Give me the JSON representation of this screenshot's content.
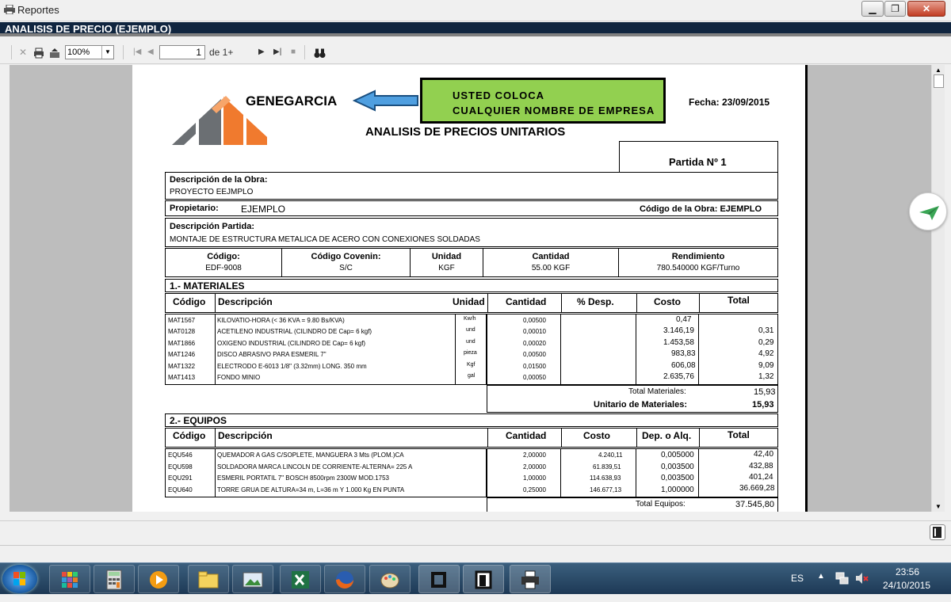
{
  "window": {
    "title": "Reportes"
  },
  "report_header": "ANALISIS DE PRECIO (EJEMPLO)",
  "toolbar": {
    "zoom": "100%",
    "page": "1",
    "page_of": "de 1+"
  },
  "doc": {
    "company": "GENEGARCIA",
    "note_line1": "USTED  COLOCA",
    "note_line2": "CUALQUIER NOMBRE DE EMPRESA",
    "fecha": "Fecha: 23/09/2015",
    "title": "ANALISIS DE PRECIOS UNITARIOS",
    "partida": "Partida Nº  1",
    "obra_label": "Descripción de la Obra:",
    "obra_value": "PROYECTO EEJMPLO",
    "propietario_label": "Propietario:",
    "propietario_value": "EJEMPLO",
    "codigo_obra": "Código de la Obra: EJEMPLO",
    "partida_desc_label": "Descripción Partida:",
    "partida_desc_value": "MONTAJE DE ESTRUCTURA METALICA DE ACERO CON CONEXIONES SOLDADAS",
    "info_headers": [
      "Código:",
      "Código Covenin:",
      "Unidad",
      "Cantidad",
      "Rendimiento"
    ],
    "info_values": [
      "EDF-9008",
      "S/C",
      "KGF",
      "55.00 KGF",
      "780.540000  KGF/Turno"
    ],
    "mat_title": "1.-  MATERIALES",
    "mat_headers": [
      "Código",
      "Descripción",
      "Unidad",
      "Cantidad",
      "% Desp.",
      "Costo",
      "Total"
    ],
    "materiales": [
      {
        "code": "MAT1567",
        "desc": "KILOVATIO-HORA (< 36 KVA = 9.80 Bs/KVA)",
        "unit": "Kw/h",
        "qty": "0,00500",
        "cost": "0,47",
        "total": ""
      },
      {
        "code": "MAT0128",
        "desc": "ACETILENO INDUSTRIAL (CILINDRO DE Cap= 6 kgf)",
        "unit": "und",
        "qty": "0,00010",
        "cost": "3.146,19",
        "total": "0,31"
      },
      {
        "code": "MAT1866",
        "desc": "OXIGENO INDUSTRIAL (CILINDRO DE Cap= 6 kgf)",
        "unit": "und",
        "qty": "0,00020",
        "cost": "1.453,58",
        "total": "0,29"
      },
      {
        "code": "MAT1246",
        "desc": "DISCO ABRASIVO PARA ESMERIL 7\"",
        "unit": "pieza",
        "qty": "0,00500",
        "cost": "983,83",
        "total": "4,92"
      },
      {
        "code": "MAT1322",
        "desc": "ELECTRODO E-6013 1/8\" (3.32mm) LONG. 350 mm",
        "unit": "Kgf",
        "qty": "0,01500",
        "cost": "606,08",
        "total": "9,09"
      },
      {
        "code": "MAT1413",
        "desc": "FONDO MINIO",
        "unit": "gal",
        "qty": "0,00050",
        "cost": "2.635,76",
        "total": "1,32"
      }
    ],
    "total_materiales_label": "Total Materiales:",
    "total_materiales": "15,93",
    "unitario_materiales_label": "Unitario de Materiales:",
    "unitario_materiales": "15,93",
    "eq_title": "2.-  EQUIPOS",
    "eq_headers": [
      "Código",
      "Descripción",
      "Cantidad",
      "Costo",
      "Dep. o Alq.",
      "Total"
    ],
    "equipos": [
      {
        "code": "EQU546",
        "desc": "QUEMADOR A GAS C/SOPLETE, MANGUERA 3 Mts (PLOM.)CA",
        "qty": "2,00000",
        "cost": "4.240,11",
        "dep": "0,005000",
        "total": "42,40"
      },
      {
        "code": "EQU598",
        "desc": "SOLDADORA MARCA LINCOLN DE CORRIENTE-ALTERNA= 225 A",
        "qty": "2,00000",
        "cost": "61.839,51",
        "dep": "0,003500",
        "total": "432,88"
      },
      {
        "code": "EQU291",
        "desc": "ESMERIL PORTATIL 7\" BOSCH 8500rpm 2300W MOD.1753",
        "qty": "1,00000",
        "cost": "114.638,93",
        "dep": "0,003500",
        "total": "401,24"
      },
      {
        "code": "EQU640",
        "desc": "TORRE GRUA DE ALTURA=34 m, L=36 m Y 1.000 Kg EN PUNTA",
        "qty": "0,25000",
        "cost": "146.677,13",
        "dep": "1,000000",
        "total": "36.669,28"
      }
    ],
    "total_equipos_label": "Total Equipos:",
    "total_equipos": "37.545,80"
  },
  "tray": {
    "lang": "ES",
    "time": "23:56",
    "date": "24/10/2015"
  },
  "colors": {
    "header_bg": "#10253f",
    "note_bg": "#92d050",
    "logo_orange": "#f07a2e",
    "logo_gray": "#6b6f73"
  }
}
